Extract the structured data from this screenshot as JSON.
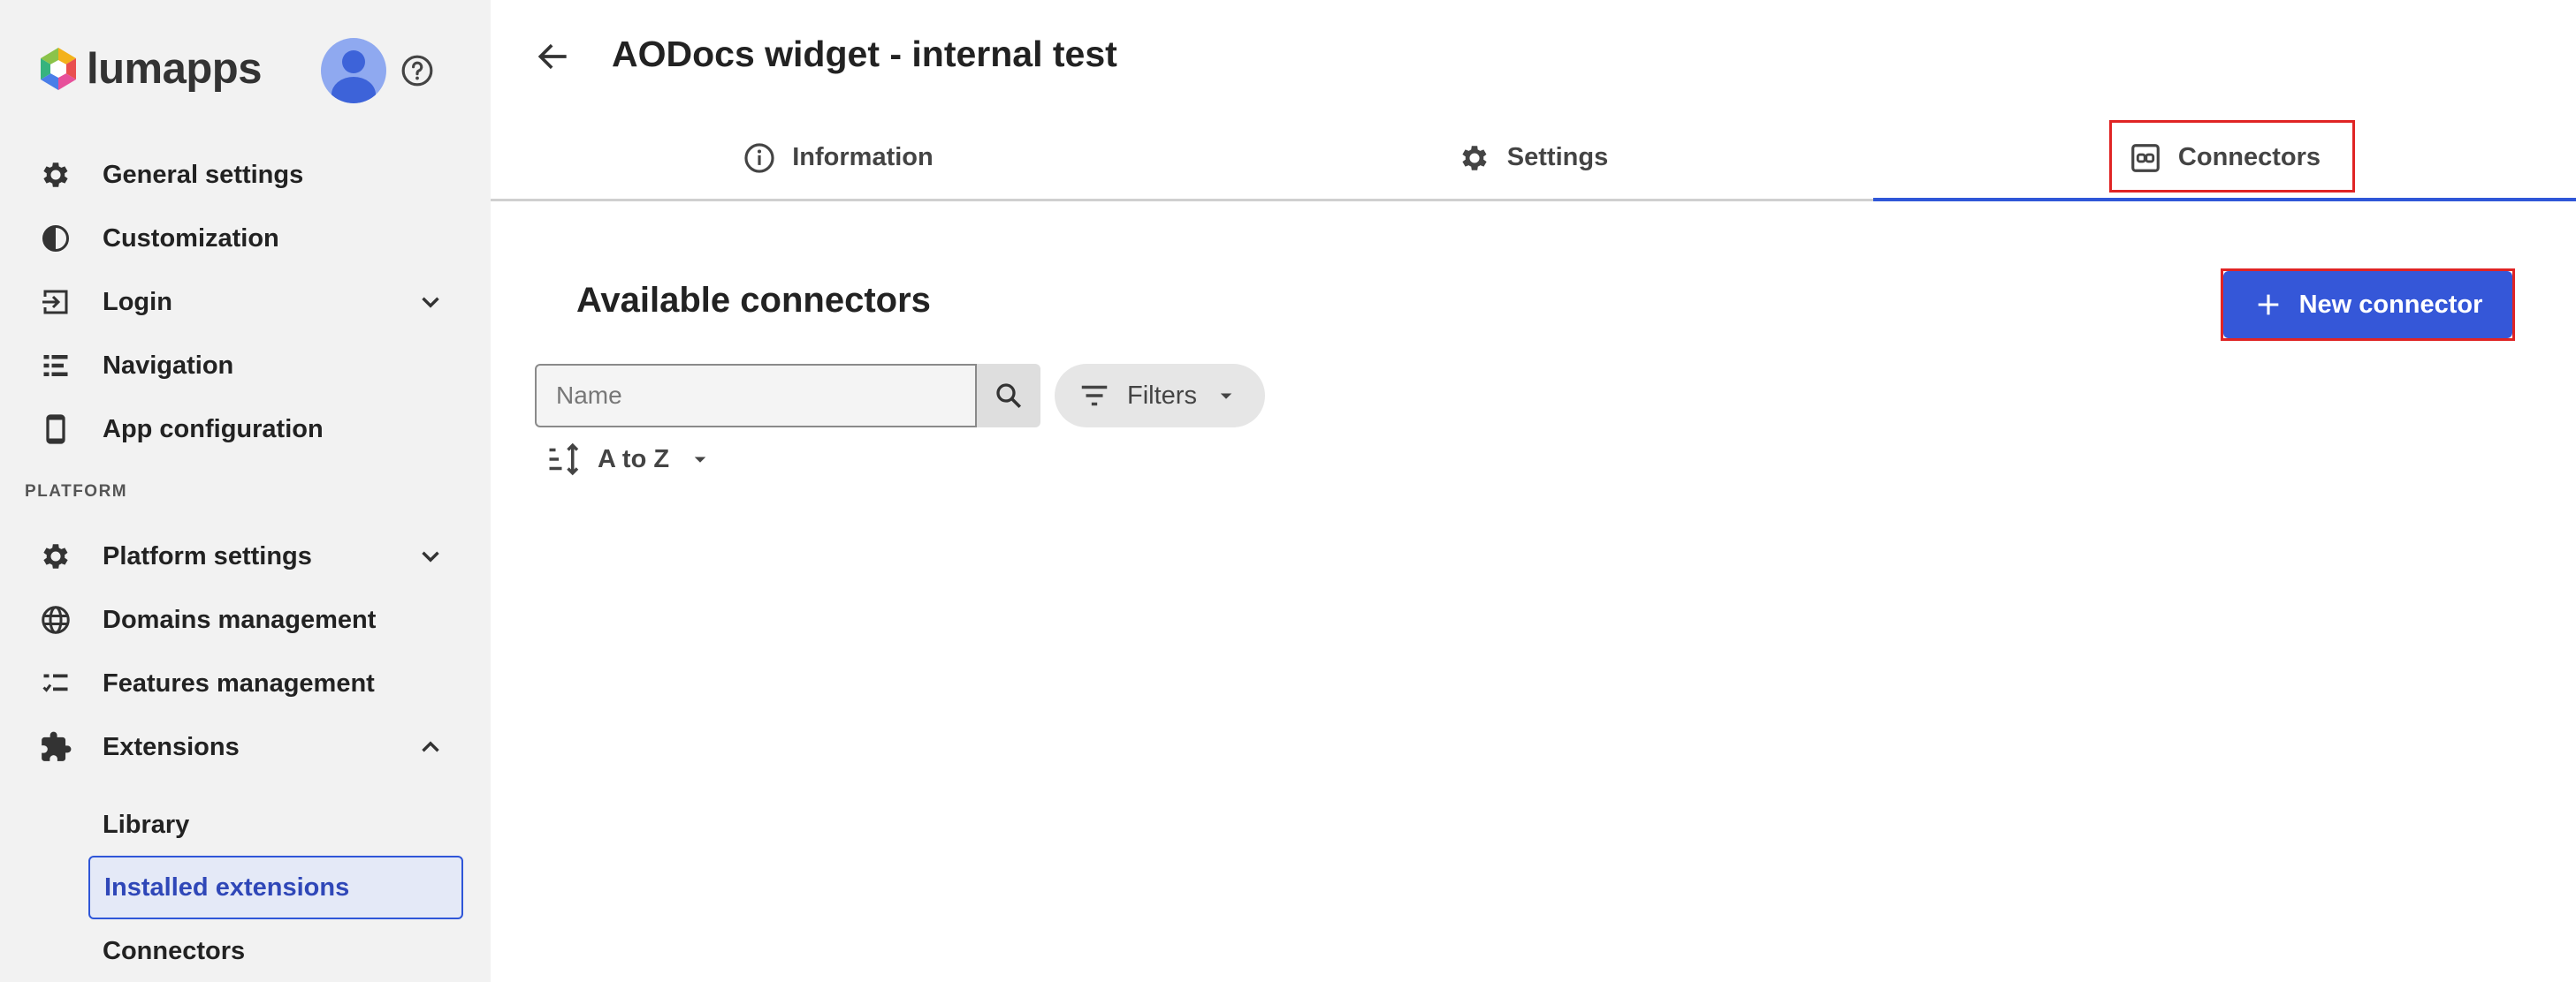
{
  "app": {
    "brand": "lumapps"
  },
  "sidebar": {
    "items": [
      {
        "label": "General settings",
        "icon": "gear-icon"
      },
      {
        "label": "Customization",
        "icon": "contrast-icon"
      },
      {
        "label": "Login",
        "icon": "login-icon",
        "expandable": true
      },
      {
        "label": "Navigation",
        "icon": "list-icon"
      },
      {
        "label": "App configuration",
        "icon": "phone-icon"
      }
    ],
    "section_label": "PLATFORM",
    "platform_items": [
      {
        "label": "Platform settings",
        "icon": "gear-icon",
        "expandable": true
      },
      {
        "label": "Domains management",
        "icon": "globe-icon"
      },
      {
        "label": "Features management",
        "icon": "checklist-icon"
      },
      {
        "label": "Extensions",
        "icon": "puzzle-icon",
        "expanded": true
      }
    ],
    "extension_subitems": [
      {
        "label": "Library"
      },
      {
        "label": "Installed extensions",
        "active": true
      },
      {
        "label": "Connectors"
      }
    ]
  },
  "header": {
    "title": "AODocs widget - internal test"
  },
  "tabs": [
    {
      "label": "Information",
      "icon": "info-icon"
    },
    {
      "label": "Settings",
      "icon": "gear-icon"
    },
    {
      "label": "Connectors",
      "icon": "connector-icon",
      "active": true
    }
  ],
  "main": {
    "section_title": "Available connectors",
    "new_button_label": "New connector",
    "search_placeholder": "Name",
    "filters_label": "Filters",
    "sort_label": "A to Z"
  },
  "colors": {
    "accent": "#3557d8",
    "highlight": "#e02424",
    "sidebar_bg": "#f2f2f2"
  }
}
